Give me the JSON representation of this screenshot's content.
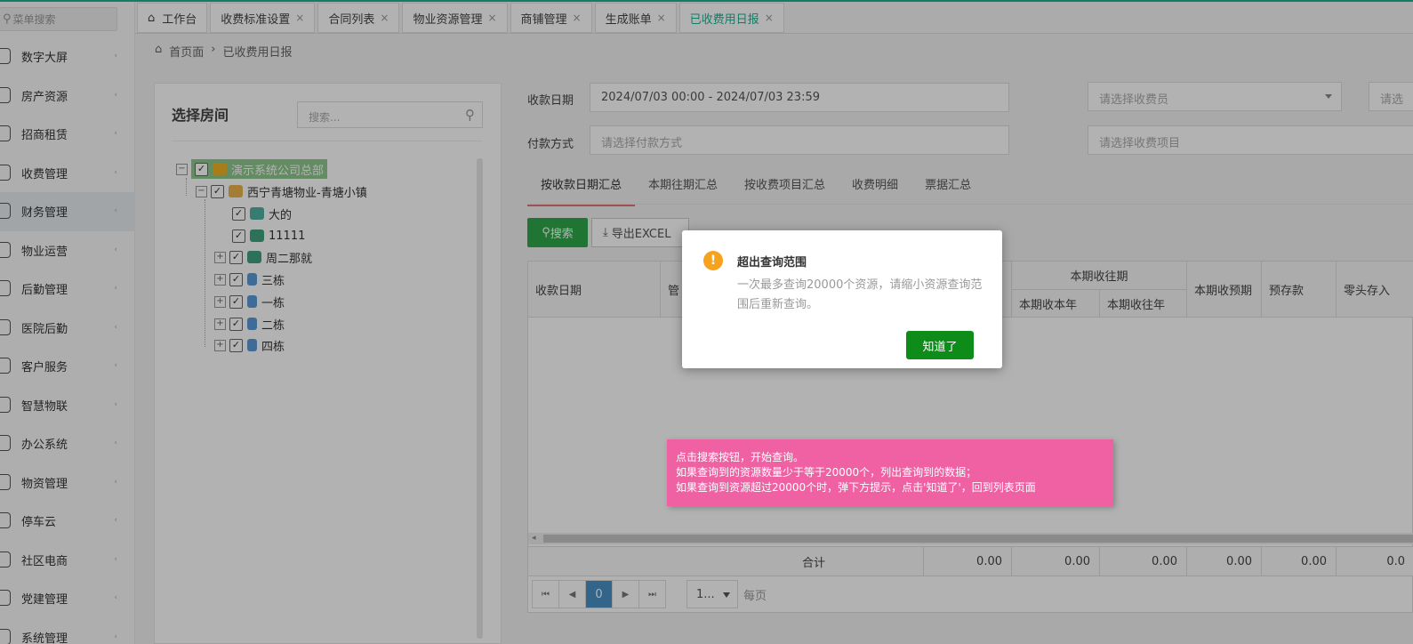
{
  "sidebar": {
    "search_placeholder": "菜单搜索",
    "items": [
      {
        "label": "数字大屏"
      },
      {
        "label": "房产资源"
      },
      {
        "label": "招商租赁"
      },
      {
        "label": "收费管理"
      },
      {
        "label": "财务管理"
      },
      {
        "label": "物业运营"
      },
      {
        "label": "后勤管理"
      },
      {
        "label": "医院后勤"
      },
      {
        "label": "客户服务"
      },
      {
        "label": "智慧物联"
      },
      {
        "label": "办公系统"
      },
      {
        "label": "物资管理"
      },
      {
        "label": "停车云"
      },
      {
        "label": "社区电商"
      },
      {
        "label": "党建管理"
      },
      {
        "label": "系统管理"
      }
    ]
  },
  "tabs": [
    {
      "label": "工作台"
    },
    {
      "label": "收费标准设置"
    },
    {
      "label": "合同列表"
    },
    {
      "label": "物业资源管理"
    },
    {
      "label": "商铺管理"
    },
    {
      "label": "生成账单"
    },
    {
      "label": "已收费用日报"
    }
  ],
  "breadcrumb": {
    "home": "首页面",
    "sep": "›",
    "current": "已收费用日报"
  },
  "room_panel": {
    "title": "选择房间",
    "search_placeholder": "搜索...",
    "tree": [
      {
        "label": "演示系统公司总部"
      },
      {
        "label": "西宁青塘物业-青塘小镇"
      },
      {
        "label": "大的"
      },
      {
        "label": "11111"
      },
      {
        "label": "周二那就"
      },
      {
        "label": "三栋"
      },
      {
        "label": "一栋"
      },
      {
        "label": "二栋"
      },
      {
        "label": "四栋"
      }
    ]
  },
  "filters": {
    "date_label": "收款日期",
    "date_value": "2024/07/03 00:00 - 2024/07/03 23:59",
    "payer_placeholder": "请选择收费员",
    "extra_placeholder": "请选",
    "method_label": "付款方式",
    "method_placeholder": "请选择付款方式",
    "item_placeholder": "请选择收费项目"
  },
  "report_tabs": [
    {
      "label": "按收款日期汇总"
    },
    {
      "label": "本期往期汇总"
    },
    {
      "label": "按收费项目汇总"
    },
    {
      "label": "收费明细"
    },
    {
      "label": "票据汇总"
    }
  ],
  "buttons": {
    "search": "搜索",
    "export": "导出EXCEL"
  },
  "table": {
    "headers": {
      "date": "收款日期",
      "col2": "管",
      "group": "本期收往期",
      "this_year": "本期收本年",
      "past_year": "本期收往年",
      "prepaid": "本期收预期",
      "deposit": "预存款",
      "change": "零头存入"
    },
    "sum_label": "合计",
    "sums": [
      "0.00",
      "0.00",
      "0.00",
      "0.00",
      "0.00",
      "0.0"
    ]
  },
  "pager": {
    "first": "⏮",
    "prev": "◀",
    "current": "0",
    "next": "▶",
    "last": "⏭",
    "size": "1...",
    "size_label": "每页"
  },
  "dialog": {
    "icon": "!",
    "title": "超出查询范围",
    "body": "一次最多查询20000个资源，请缩小资源查询范围后重新查询。",
    "button": "知道了"
  },
  "note": {
    "line1": "点击搜索按钮，开始查询。",
    "line2": "如果查询到的资源数量少于等于20000个，列出查询到的数据；",
    "line3": "如果查询到资源超过20000个时，弹下方提示，点击'知道了'，回到列表页面"
  },
  "colors": {
    "accent": "#1ab394",
    "search_btn": "#2ea84b",
    "confirm_btn": "#0e8c1a",
    "note_bg": "#f061a4",
    "warn_icon": "#f6a21c"
  }
}
